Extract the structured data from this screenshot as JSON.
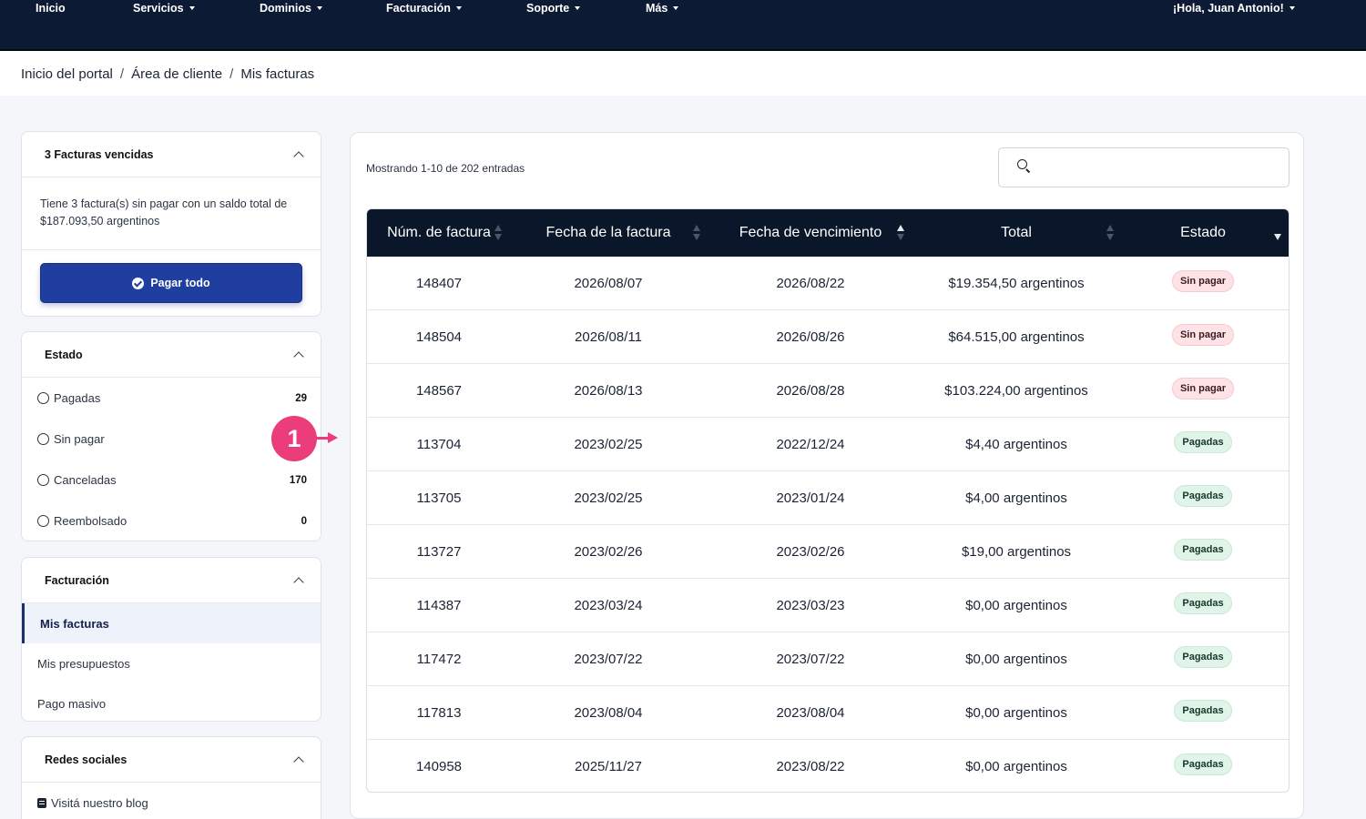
{
  "nav": {
    "items": [
      {
        "label": "Inicio",
        "dropdown": false
      },
      {
        "label": "Servicios",
        "dropdown": true
      },
      {
        "label": "Dominios",
        "dropdown": true
      },
      {
        "label": "Facturación",
        "dropdown": true
      },
      {
        "label": "Soporte",
        "dropdown": true
      },
      {
        "label": "Más",
        "dropdown": true
      }
    ],
    "greeting": "¡Hola, Juan Antonio!"
  },
  "breadcrumb": [
    "Inicio del portal",
    "Área de cliente",
    "Mis facturas"
  ],
  "sidebar": {
    "overdue": {
      "title": "3 Facturas vencidas",
      "text": "Tiene 3 factura(s) sin pagar con un saldo total de $187.093,50 argentinos",
      "button": "Pagar todo"
    },
    "status": {
      "title": "Estado",
      "items": [
        {
          "label": "Pagadas",
          "count": "29"
        },
        {
          "label": "Sin pagar",
          "count": ""
        },
        {
          "label": "Canceladas",
          "count": "170"
        },
        {
          "label": "Reembolsado",
          "count": "0"
        }
      ]
    },
    "billing": {
      "title": "Facturación",
      "items": [
        "Mis facturas",
        "Mis presupuestos",
        "Pago masivo"
      ],
      "active_index": 0
    },
    "social": {
      "title": "Redes sociales",
      "items": [
        "Visitá nuestro blog"
      ]
    }
  },
  "callout": {
    "number": "1",
    "color": "#ec3d7b"
  },
  "main": {
    "showing": "Mostrando 1-10 de 202 entradas",
    "search": {
      "placeholder": "",
      "value": ""
    },
    "columns": [
      "Núm. de factura",
      "Fecha de la factura",
      "Fecha de vencimiento",
      "Total",
      "Estado"
    ],
    "sort": {
      "column": "Fecha de vencimiento",
      "direction": "asc"
    },
    "rows": [
      {
        "id": "148407",
        "date": "2026/08/07",
        "due": "2026/08/22",
        "total": "$19.354,50 argentinos",
        "status": "Sin pagar",
        "status_type": "unpaid"
      },
      {
        "id": "148504",
        "date": "2026/08/11",
        "due": "2026/08/26",
        "total": "$64.515,00 argentinos",
        "status": "Sin pagar",
        "status_type": "unpaid"
      },
      {
        "id": "148567",
        "date": "2026/08/13",
        "due": "2026/08/28",
        "total": "$103.224,00 argentinos",
        "status": "Sin pagar",
        "status_type": "unpaid"
      },
      {
        "id": "113704",
        "date": "2023/02/25",
        "due": "2022/12/24",
        "total": "$4,40 argentinos",
        "status": "Pagadas",
        "status_type": "paid"
      },
      {
        "id": "113705",
        "date": "2023/02/25",
        "due": "2023/01/24",
        "total": "$4,00 argentinos",
        "status": "Pagadas",
        "status_type": "paid"
      },
      {
        "id": "113727",
        "date": "2023/02/26",
        "due": "2023/02/26",
        "total": "$19,00 argentinos",
        "status": "Pagadas",
        "status_type": "paid"
      },
      {
        "id": "114387",
        "date": "2023/03/24",
        "due": "2023/03/23",
        "total": "$0,00 argentinos",
        "status": "Pagadas",
        "status_type": "paid"
      },
      {
        "id": "117472",
        "date": "2023/07/22",
        "due": "2023/07/22",
        "total": "$0,00 argentinos",
        "status": "Pagadas",
        "status_type": "paid"
      },
      {
        "id": "117813",
        "date": "2023/08/04",
        "due": "2023/08/04",
        "total": "$0,00 argentinos",
        "status": "Pagadas",
        "status_type": "paid"
      },
      {
        "id": "140958",
        "date": "2025/11/27",
        "due": "2023/08/22",
        "total": "$0,00 argentinos",
        "status": "Pagadas",
        "status_type": "paid"
      }
    ]
  },
  "colors": {
    "nav_bg": "#0d1a33",
    "table_head_bg": "#0a1629",
    "primary_button": "#1f3ea0",
    "unpaid_badge": "#fde3e6",
    "paid_badge": "#e1f4ea"
  }
}
